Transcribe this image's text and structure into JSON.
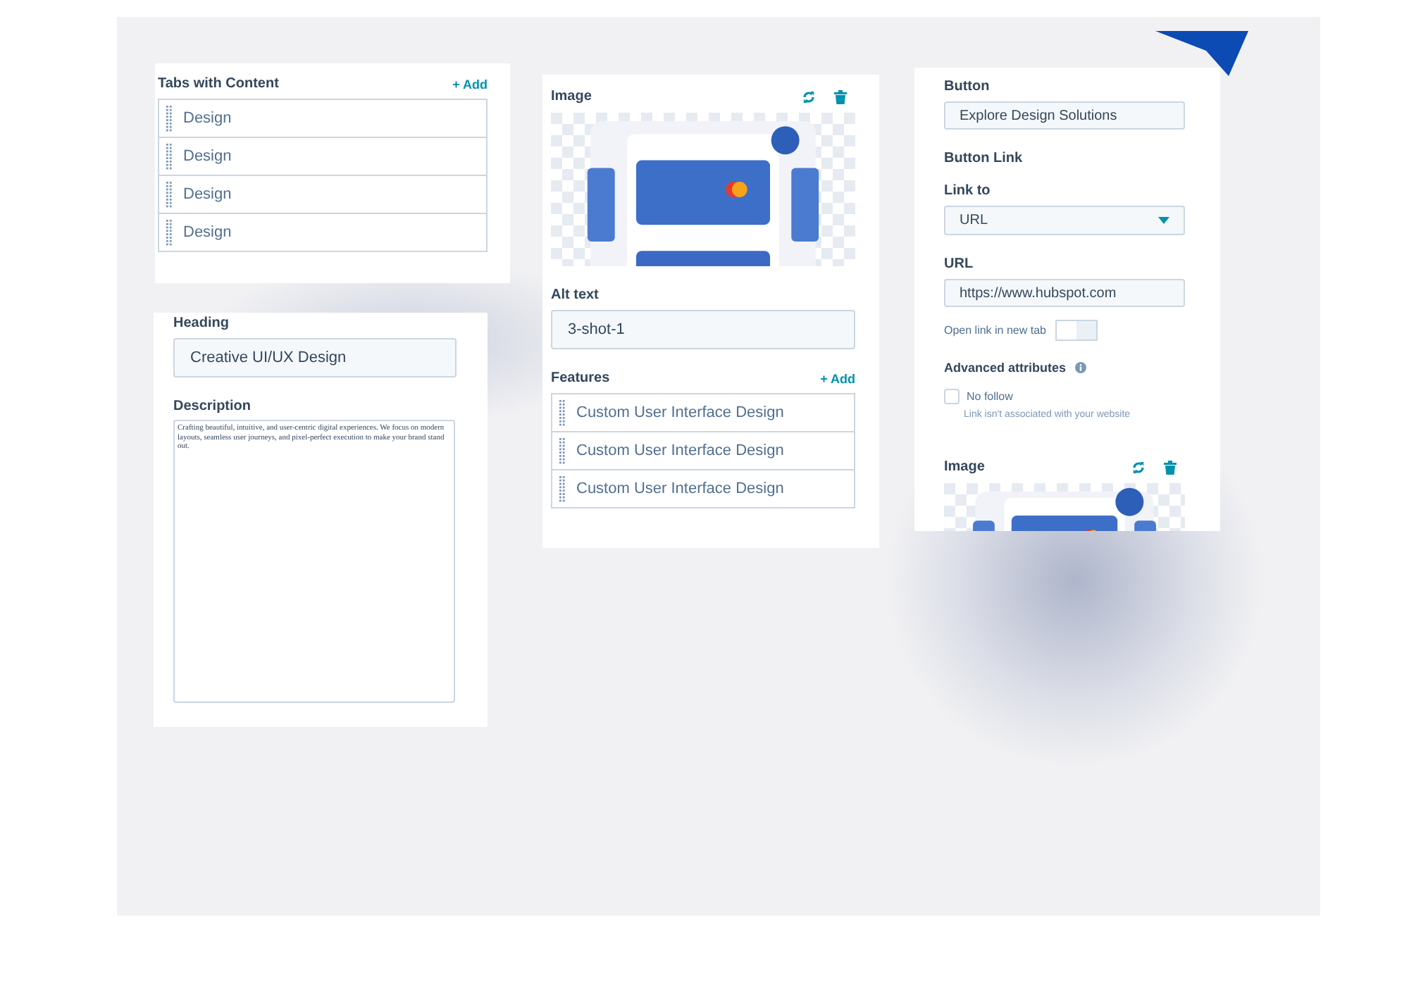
{
  "tabs_panel": {
    "title": "Tabs with Content",
    "add_link": "+ Add",
    "items": [
      {
        "label": "Design"
      },
      {
        "label": "Design"
      },
      {
        "label": "Design"
      },
      {
        "label": "Design"
      }
    ]
  },
  "text_panel": {
    "heading_label": "Heading",
    "heading_value": "Creative UI/UX Design",
    "description_label": "Description",
    "description_value": "Crafting beautiful, intuitive, and user-centric digital experiences. We focus on modern layouts, seamless user journeys, and pixel-perfect execution to make your brand stand out."
  },
  "image_panel": {
    "image_label": "Image",
    "alt_label": "Alt text",
    "alt_value": "3-shot-1",
    "features_title": "Features",
    "add_link": "+ Add",
    "features": [
      {
        "label": "Custom User Interface Design"
      },
      {
        "label": "Custom User Interface Design"
      },
      {
        "label": "Custom User Interface Design"
      }
    ]
  },
  "button_panel": {
    "button_label": "Button",
    "button_value": "Explore Design Solutions",
    "link_section": "Button Link",
    "link_to_label": "Link to",
    "link_to_value": "URL",
    "url_label": "URL",
    "url_value": "https://www.hubspot.com",
    "new_tab_label": "Open link in new tab",
    "new_tab_on": false,
    "advanced_label": "Advanced attributes",
    "nofollow": {
      "label": "No follow",
      "checked": false
    },
    "nofollow_hint": "Link isn't associated with your website",
    "image_label": "Image"
  }
}
